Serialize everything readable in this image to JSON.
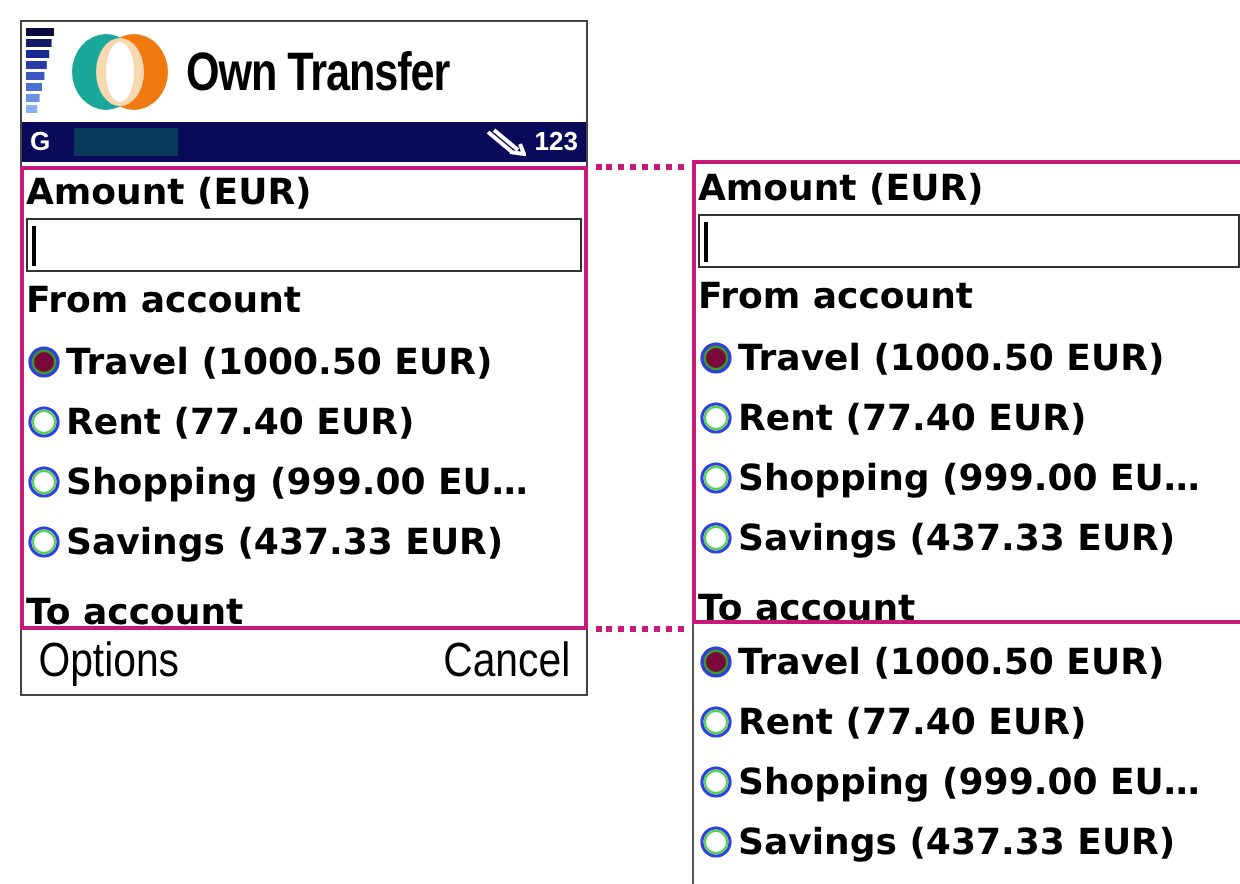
{
  "phone": {
    "title": "Own Transfer",
    "status_bar": {
      "network": "G",
      "input_mode": "123"
    },
    "form": {
      "amount_label": "Amount (EUR)",
      "from_label": "From account",
      "from_accounts": [
        {
          "label": "Travel (1000.50 EUR)",
          "selected": true
        },
        {
          "label": "Rent (77.40 EUR)",
          "selected": false
        },
        {
          "label": "Shopping (999.00 EU…",
          "selected": false
        },
        {
          "label": "Savings (437.33 EUR)",
          "selected": false
        }
      ],
      "to_label": "To account"
    },
    "softkeys": [
      "Options",
      "Cancel"
    ]
  },
  "expanded_form": {
    "amount_label": "Amount (EUR)",
    "from_label": "From account",
    "from_accounts": [
      {
        "label": "Travel (1000.50 EUR)",
        "selected": true
      },
      {
        "label": "Rent (77.40 EUR)",
        "selected": false
      },
      {
        "label": "Shopping (999.00 EU…",
        "selected": false
      },
      {
        "label": "Savings (437.33 EUR)",
        "selected": false
      }
    ],
    "to_label": "To account",
    "to_accounts": [
      {
        "label": "Travel (1000.50 EUR)",
        "selected": true
      },
      {
        "label": "Rent (77.40 EUR)",
        "selected": false
      },
      {
        "label": "Shopping (999.00 EU…",
        "selected": false
      },
      {
        "label": "Savings (437.33 EUR)",
        "selected": false
      }
    ]
  }
}
